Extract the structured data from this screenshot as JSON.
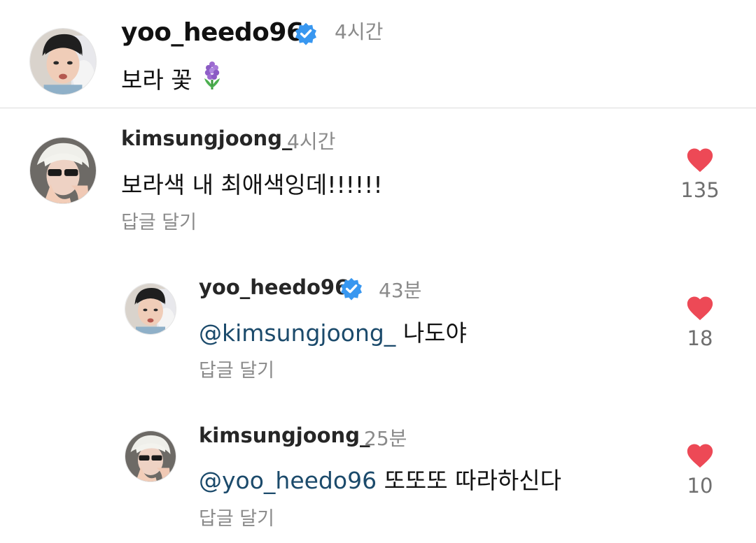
{
  "caption": {
    "username": "yoo_heedo96",
    "time": "4시간",
    "text": "보라 꽃",
    "flower_icon": "hyacinth-icon"
  },
  "comments": [
    {
      "username": "kimsungjoong_",
      "time": "4시간",
      "text": "보라색 내 최애색잉데!!!!!!",
      "likes": "135",
      "reply_label": "답글 달기"
    },
    {
      "username": "yoo_heedo96",
      "time": "43분",
      "mention": "@kimsungjoong_",
      "text": "나도야",
      "likes": "18",
      "reply_label": "답글 달기"
    },
    {
      "username": "kimsungjoong_",
      "time": "25분",
      "mention": "@yoo_heedo96",
      "text": "또또또 따라하신다",
      "likes": "10",
      "reply_label": "답글 달기"
    }
  ],
  "colors": {
    "heart": "#ed4956",
    "verified": "#3897f0",
    "mention": "#1b4a6b",
    "muted": "#8a8a8a"
  }
}
